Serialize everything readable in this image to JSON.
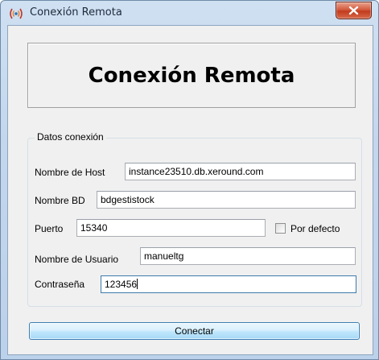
{
  "window": {
    "title": "Conexión Remota"
  },
  "banner": {
    "heading": "Conexión Remota"
  },
  "connection_group": {
    "legend": "Datos conexión",
    "fields": {
      "host": {
        "label": "Nombre de Host",
        "value": "instance23510.db.xeround.com"
      },
      "database": {
        "label": "Nombre BD",
        "value": "bdgestistock"
      },
      "port": {
        "label": "Puerto",
        "value": "15340"
      },
      "username": {
        "label": "Nombre de Usuario",
        "value": "manueltg"
      },
      "password": {
        "label": "Contraseña",
        "value": "123456"
      }
    },
    "default_port_checkbox": {
      "label": "Por defecto",
      "checked": false
    }
  },
  "actions": {
    "connect_label": "Conectar"
  },
  "colors": {
    "titlebar": "#c3d6ec",
    "close_button": "#c23b1e",
    "button_border": "#3c7fb1",
    "focused_border": "#3d7bad"
  },
  "icons": {
    "window": "wireless-signal-icon",
    "close": "close-icon"
  }
}
